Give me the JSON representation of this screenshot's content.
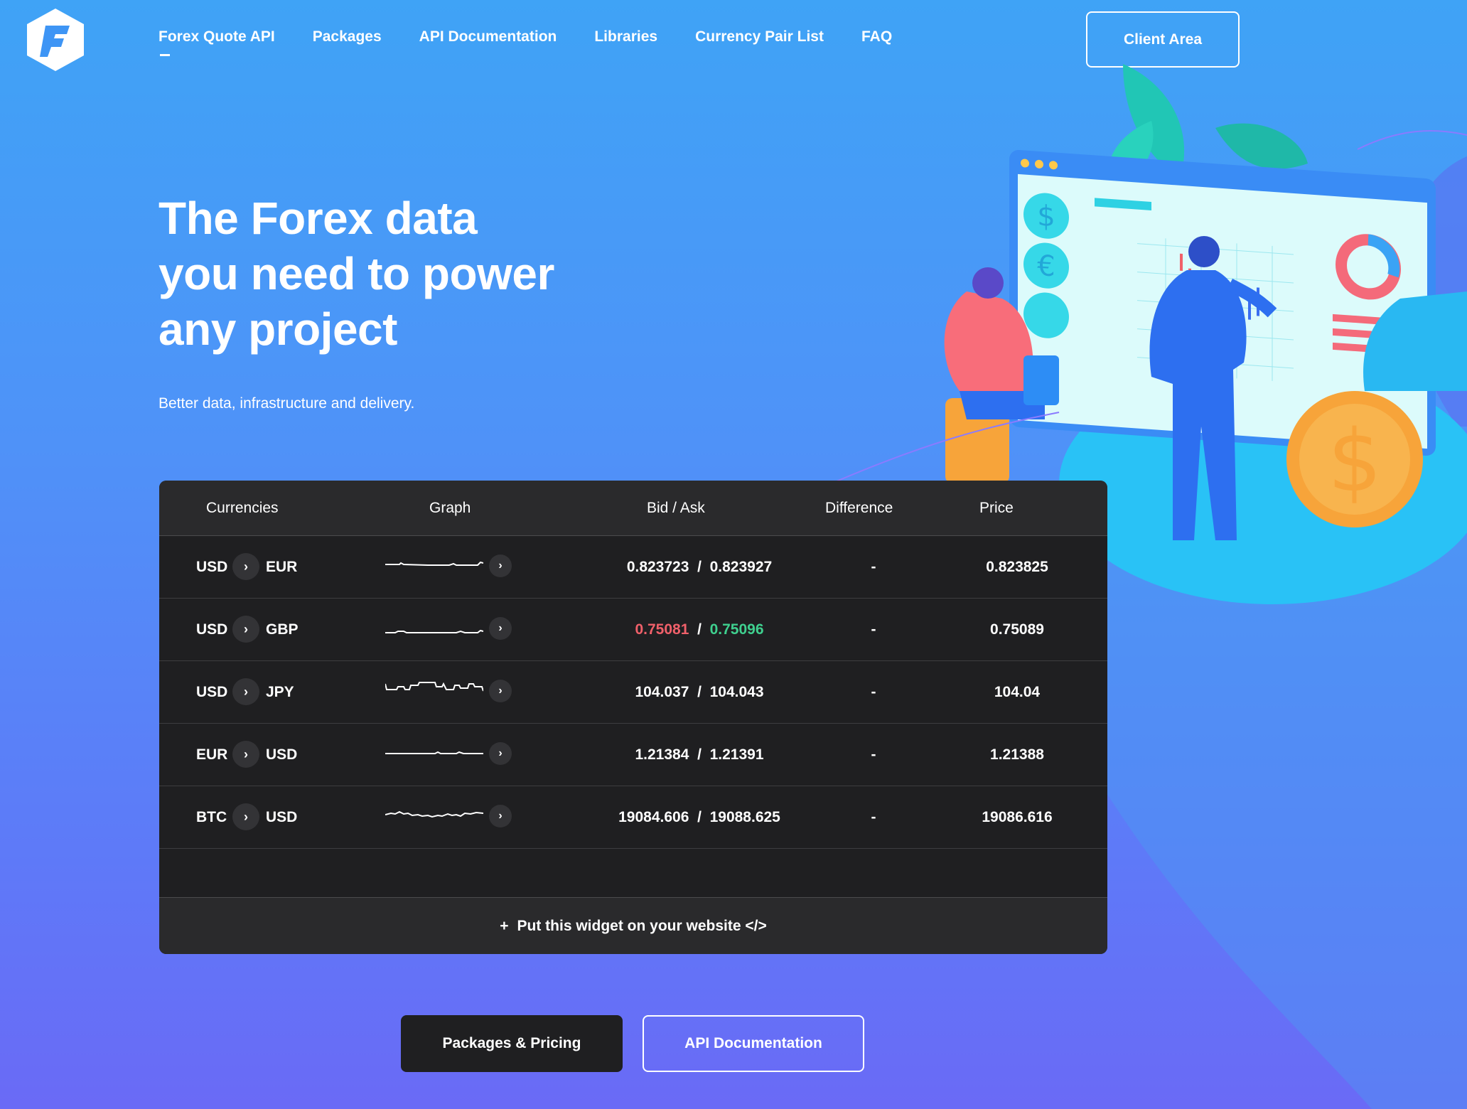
{
  "nav": {
    "items": [
      {
        "label": "Forex Quote API",
        "active": true
      },
      {
        "label": "Packages",
        "active": false
      },
      {
        "label": "API Documentation",
        "active": false
      },
      {
        "label": "Libraries",
        "active": false
      },
      {
        "label": "Currency Pair List",
        "active": false
      },
      {
        "label": "FAQ",
        "active": false
      }
    ],
    "client_area": "Client Area"
  },
  "hero": {
    "title": "The Forex data\nyou need to power\nany project",
    "subtitle": "Better data, infrastructure and delivery."
  },
  "widget": {
    "headers": {
      "currencies": "Currencies",
      "graph": "Graph",
      "bid_ask": "Bid / Ask",
      "difference": "Difference",
      "price": "Price"
    },
    "rows": [
      {
        "from": "USD",
        "to": "EUR",
        "bid": "0.823723",
        "ask": "0.823927",
        "difference": "-",
        "price": "0.823825",
        "trend": "flat"
      },
      {
        "from": "USD",
        "to": "GBP",
        "bid": "0.75081",
        "ask": "0.75096",
        "difference": "-",
        "price": "0.75089",
        "trend": "bid-down-ask-up"
      },
      {
        "from": "USD",
        "to": "JPY",
        "bid": "104.037",
        "ask": "104.043",
        "difference": "-",
        "price": "104.04",
        "trend": "flat"
      },
      {
        "from": "EUR",
        "to": "USD",
        "bid": "1.21384",
        "ask": "1.21391",
        "difference": "-",
        "price": "1.21388",
        "trend": "flat"
      },
      {
        "from": "BTC",
        "to": "USD",
        "bid": "19084.606",
        "ask": "19088.625",
        "difference": "-",
        "price": "19086.616",
        "trend": "flat"
      }
    ],
    "separator": "/",
    "footer": {
      "plus": "+",
      "label": "Put this widget on your website </>"
    }
  },
  "cta": {
    "primary": "Packages & Pricing",
    "secondary": "API Documentation"
  },
  "colors": {
    "brand": "#3fa3f6",
    "widget_bg": "#1f1f21",
    "bid_down": "#f0606a",
    "ask_up": "#3fd08f"
  },
  "icons": {
    "logo": "hexagon-f-logo-icon",
    "pair_arrow": "chevron-right-icon",
    "graph_arrow": "chevron-right-icon"
  }
}
